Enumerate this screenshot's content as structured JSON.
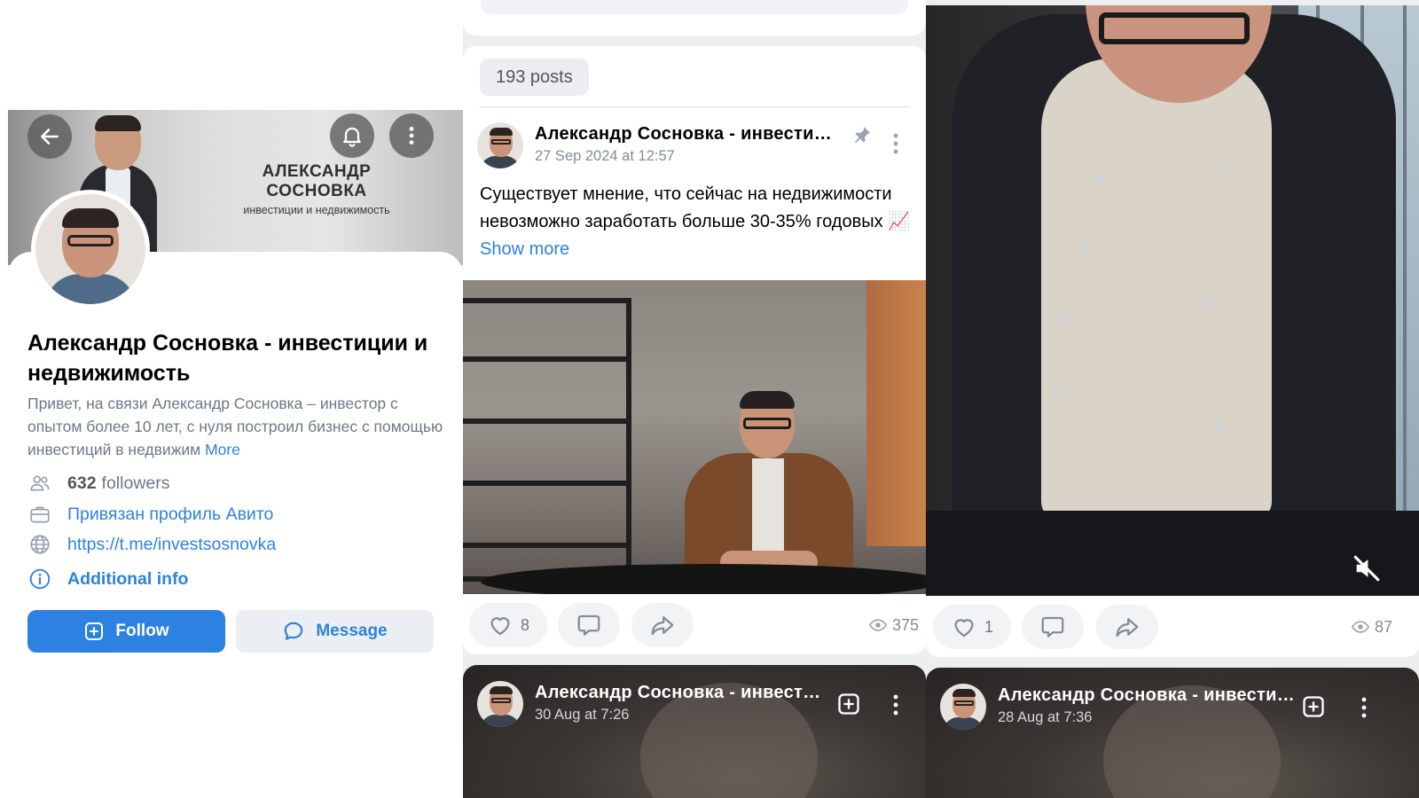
{
  "profile": {
    "cover_name": "АЛЕКСАНДР СОСНОВКА",
    "cover_tagline": "инвестиции и недвижимость",
    "name": "Александр Сосновка - инвестиции и недвижимость",
    "bio": "Привет, на связи Александр Сосновка – инвестор с опытом более 10 лет, с нуля построил бизнес с помощью инвестиций в недвижим",
    "bio_more": "More",
    "followers_count": "632",
    "followers_label": "followers",
    "avito": "Привязан профиль Авито",
    "link": "https://t.me/investsosnovka",
    "additional_info": "Additional info",
    "follow_label": "Follow",
    "message_label": "Message"
  },
  "feed": {
    "posts_count": "193 posts",
    "post": {
      "author": "Александр Сосновка - инвестиции и недвижимость",
      "date": "27 Sep 2024 at 12:57",
      "text": "Существует мнение, что сейчас на недвижимости невозможно заработать больше 30-35% годовых 📈",
      "show_more": "Show more",
      "likes": "8",
      "views": "375"
    },
    "next_post": {
      "author": "Александр Сосновка - инвестиции и недвижимость",
      "date": "30 Aug at 7:26"
    }
  },
  "video": {
    "likes": "1",
    "views": "87",
    "next_post": {
      "author": "Александр Сосновка - инвестиции и недвижимость",
      "date": "28 Aug at 7:36"
    }
  },
  "colors": {
    "accent": "#2d81e0",
    "muted_text": "#6d7885",
    "background": "#edeef0"
  },
  "icons": [
    "arrow-left-icon",
    "bell-icon",
    "more-vertical-icon",
    "followers-icon",
    "briefcase-icon",
    "globe-icon",
    "info-icon",
    "plus-square-icon",
    "chat-bubble-icon",
    "pin-icon",
    "heart-icon",
    "comment-icon",
    "share-icon",
    "eye-icon",
    "mute-icon"
  ]
}
